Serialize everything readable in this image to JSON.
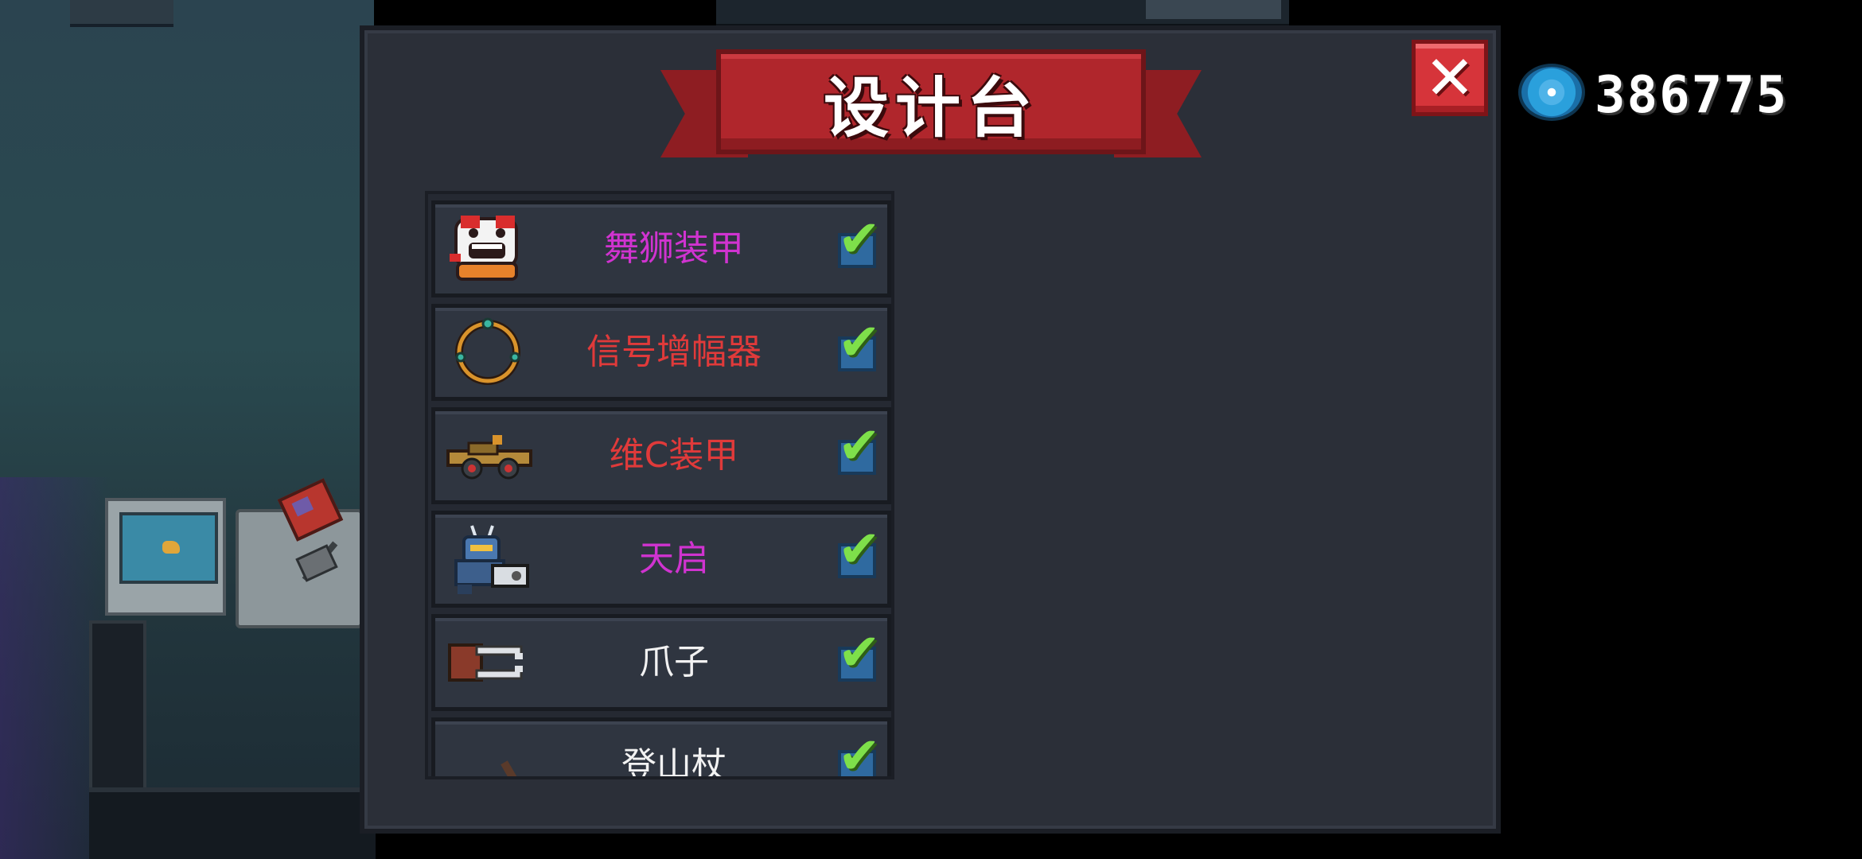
{
  "screen": {
    "title": "设计台"
  },
  "currency": {
    "icon": "gem-icon",
    "amount": "386775",
    "color": "#4fb3e8"
  },
  "close": {
    "icon": "close-icon",
    "label": "✕"
  },
  "items": [
    {
      "name": "舞狮装甲",
      "color": "#d033d0",
      "icon": "lion-dance-armor-icon",
      "checked": true
    },
    {
      "name": "信号增幅器",
      "color": "#e03a3a",
      "icon": "signal-amplifier-ring-icon",
      "checked": true
    },
    {
      "name": "维C装甲",
      "color": "#e03a3a",
      "icon": "vitamin-c-armor-icon",
      "checked": true
    },
    {
      "name": "天启",
      "color": "#d033d0",
      "icon": "apocalypse-mech-icon",
      "checked": true
    },
    {
      "name": "爪子",
      "color": "#f2f2f2",
      "icon": "claw-icon",
      "checked": true
    },
    {
      "name": "登山杖",
      "color": "#f2f2f2",
      "icon": "trekking-pole-icon",
      "checked": true
    }
  ],
  "check_glyph": "✔"
}
